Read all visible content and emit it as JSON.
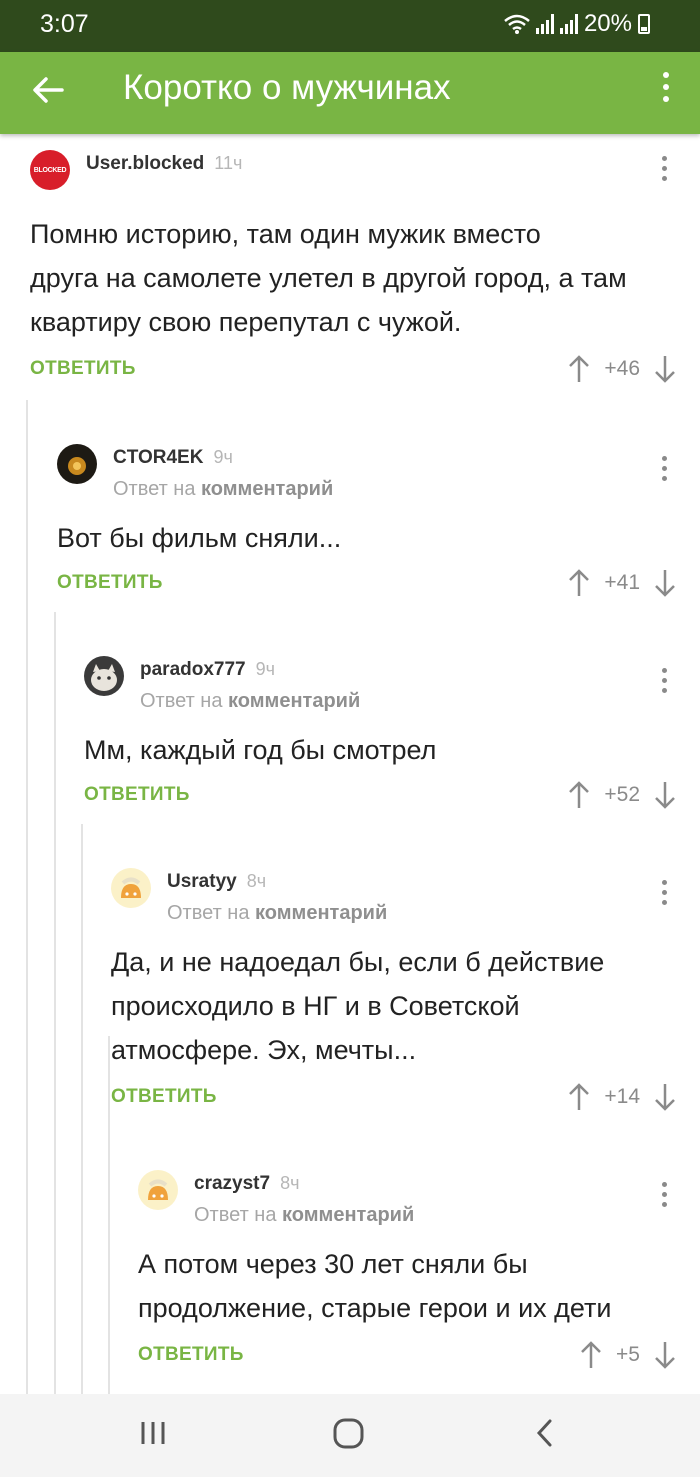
{
  "status": {
    "time": "3:07",
    "battery": "20%"
  },
  "app": {
    "title": "Коротко о мужчинах"
  },
  "avatars": {
    "user_blocked_badge": "BLOCKED"
  },
  "labels": {
    "reply_prefix": "Ответ на",
    "reply_target": "комментарий",
    "reply_button": "ОТВЕТИТЬ"
  },
  "comments": [
    {
      "user": "User.blocked",
      "time": "11ч",
      "reply_line": false,
      "text": [
        "Помню историю, там один мужик вместо",
        "друга на самолете улетел в другой город, а там",
        "квартиру свою перепутал с чужой."
      ],
      "rating": "+46"
    },
    {
      "user": "CTOR4EK",
      "time": "9ч",
      "reply_line": true,
      "text": [
        "Вот бы фильм сняли..."
      ],
      "rating": "+41"
    },
    {
      "user": "paradox777",
      "time": "9ч",
      "reply_line": true,
      "text": [
        "Мм, каждый год бы смотрел"
      ],
      "rating": "+52"
    },
    {
      "user": "Usratyy",
      "time": "8ч",
      "reply_line": true,
      "text": [
        "Да, и не надоедал бы, если б действие",
        "происходило в НГ и в Советской",
        "атмосфере. Эх, мечты..."
      ],
      "rating": "+14"
    },
    {
      "user": "crazyst7",
      "time": "8ч",
      "reply_line": true,
      "text": [
        "А потом через 30 лет сняли бы",
        "продолжение, старые герои и их дети"
      ],
      "rating": "+5"
    }
  ],
  "icons": {
    "back": "arrow-left-icon",
    "menu": "more-vertical-icon",
    "up": "arrow-up-icon",
    "down": "arrow-down-icon"
  },
  "colors": {
    "status_bar": "#2f4a1c",
    "app_bar": "#79b544",
    "accent": "#79b544"
  }
}
